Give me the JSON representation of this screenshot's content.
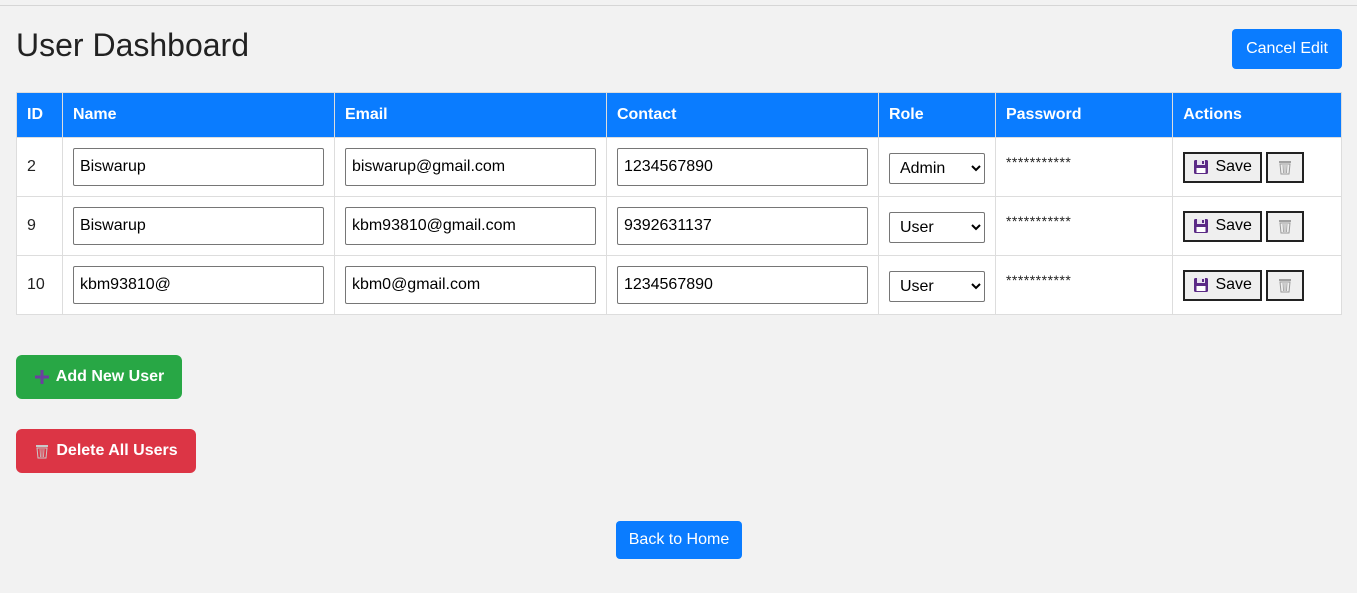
{
  "header": {
    "title": "User Dashboard",
    "cancel_label": "Cancel Edit"
  },
  "table": {
    "columns": [
      "ID",
      "Name",
      "Email",
      "Contact",
      "Role",
      "Password",
      "Actions"
    ],
    "rows": [
      {
        "id": "2",
        "name": "Biswarup",
        "email": "biswarup@gmail.com",
        "contact": "1234567890",
        "role": "Admin",
        "password": "***********",
        "save_label": "Save"
      },
      {
        "id": "9",
        "name": "Biswarup",
        "email": "kbm93810@gmail.com",
        "contact": "9392631137",
        "role": "User",
        "password": "***********",
        "save_label": "Save"
      },
      {
        "id": "10",
        "name": "kbm93810@",
        "email": "kbm0@gmail.com",
        "contact": "1234567890",
        "role": "User",
        "password": "***********",
        "save_label": "Save"
      }
    ],
    "role_options": [
      "Admin",
      "User"
    ]
  },
  "actions": {
    "add_label": "Add New User",
    "delete_all_label": "Delete All Users",
    "home_label": "Back to Home"
  },
  "icons": {
    "save": "floppy-disk-icon",
    "trash": "wastebasket-icon",
    "add": "plus-icon"
  },
  "colors": {
    "primary": "#0a7cff",
    "success": "#28a745",
    "danger": "#dc3545",
    "background": "#f2f2f2"
  }
}
